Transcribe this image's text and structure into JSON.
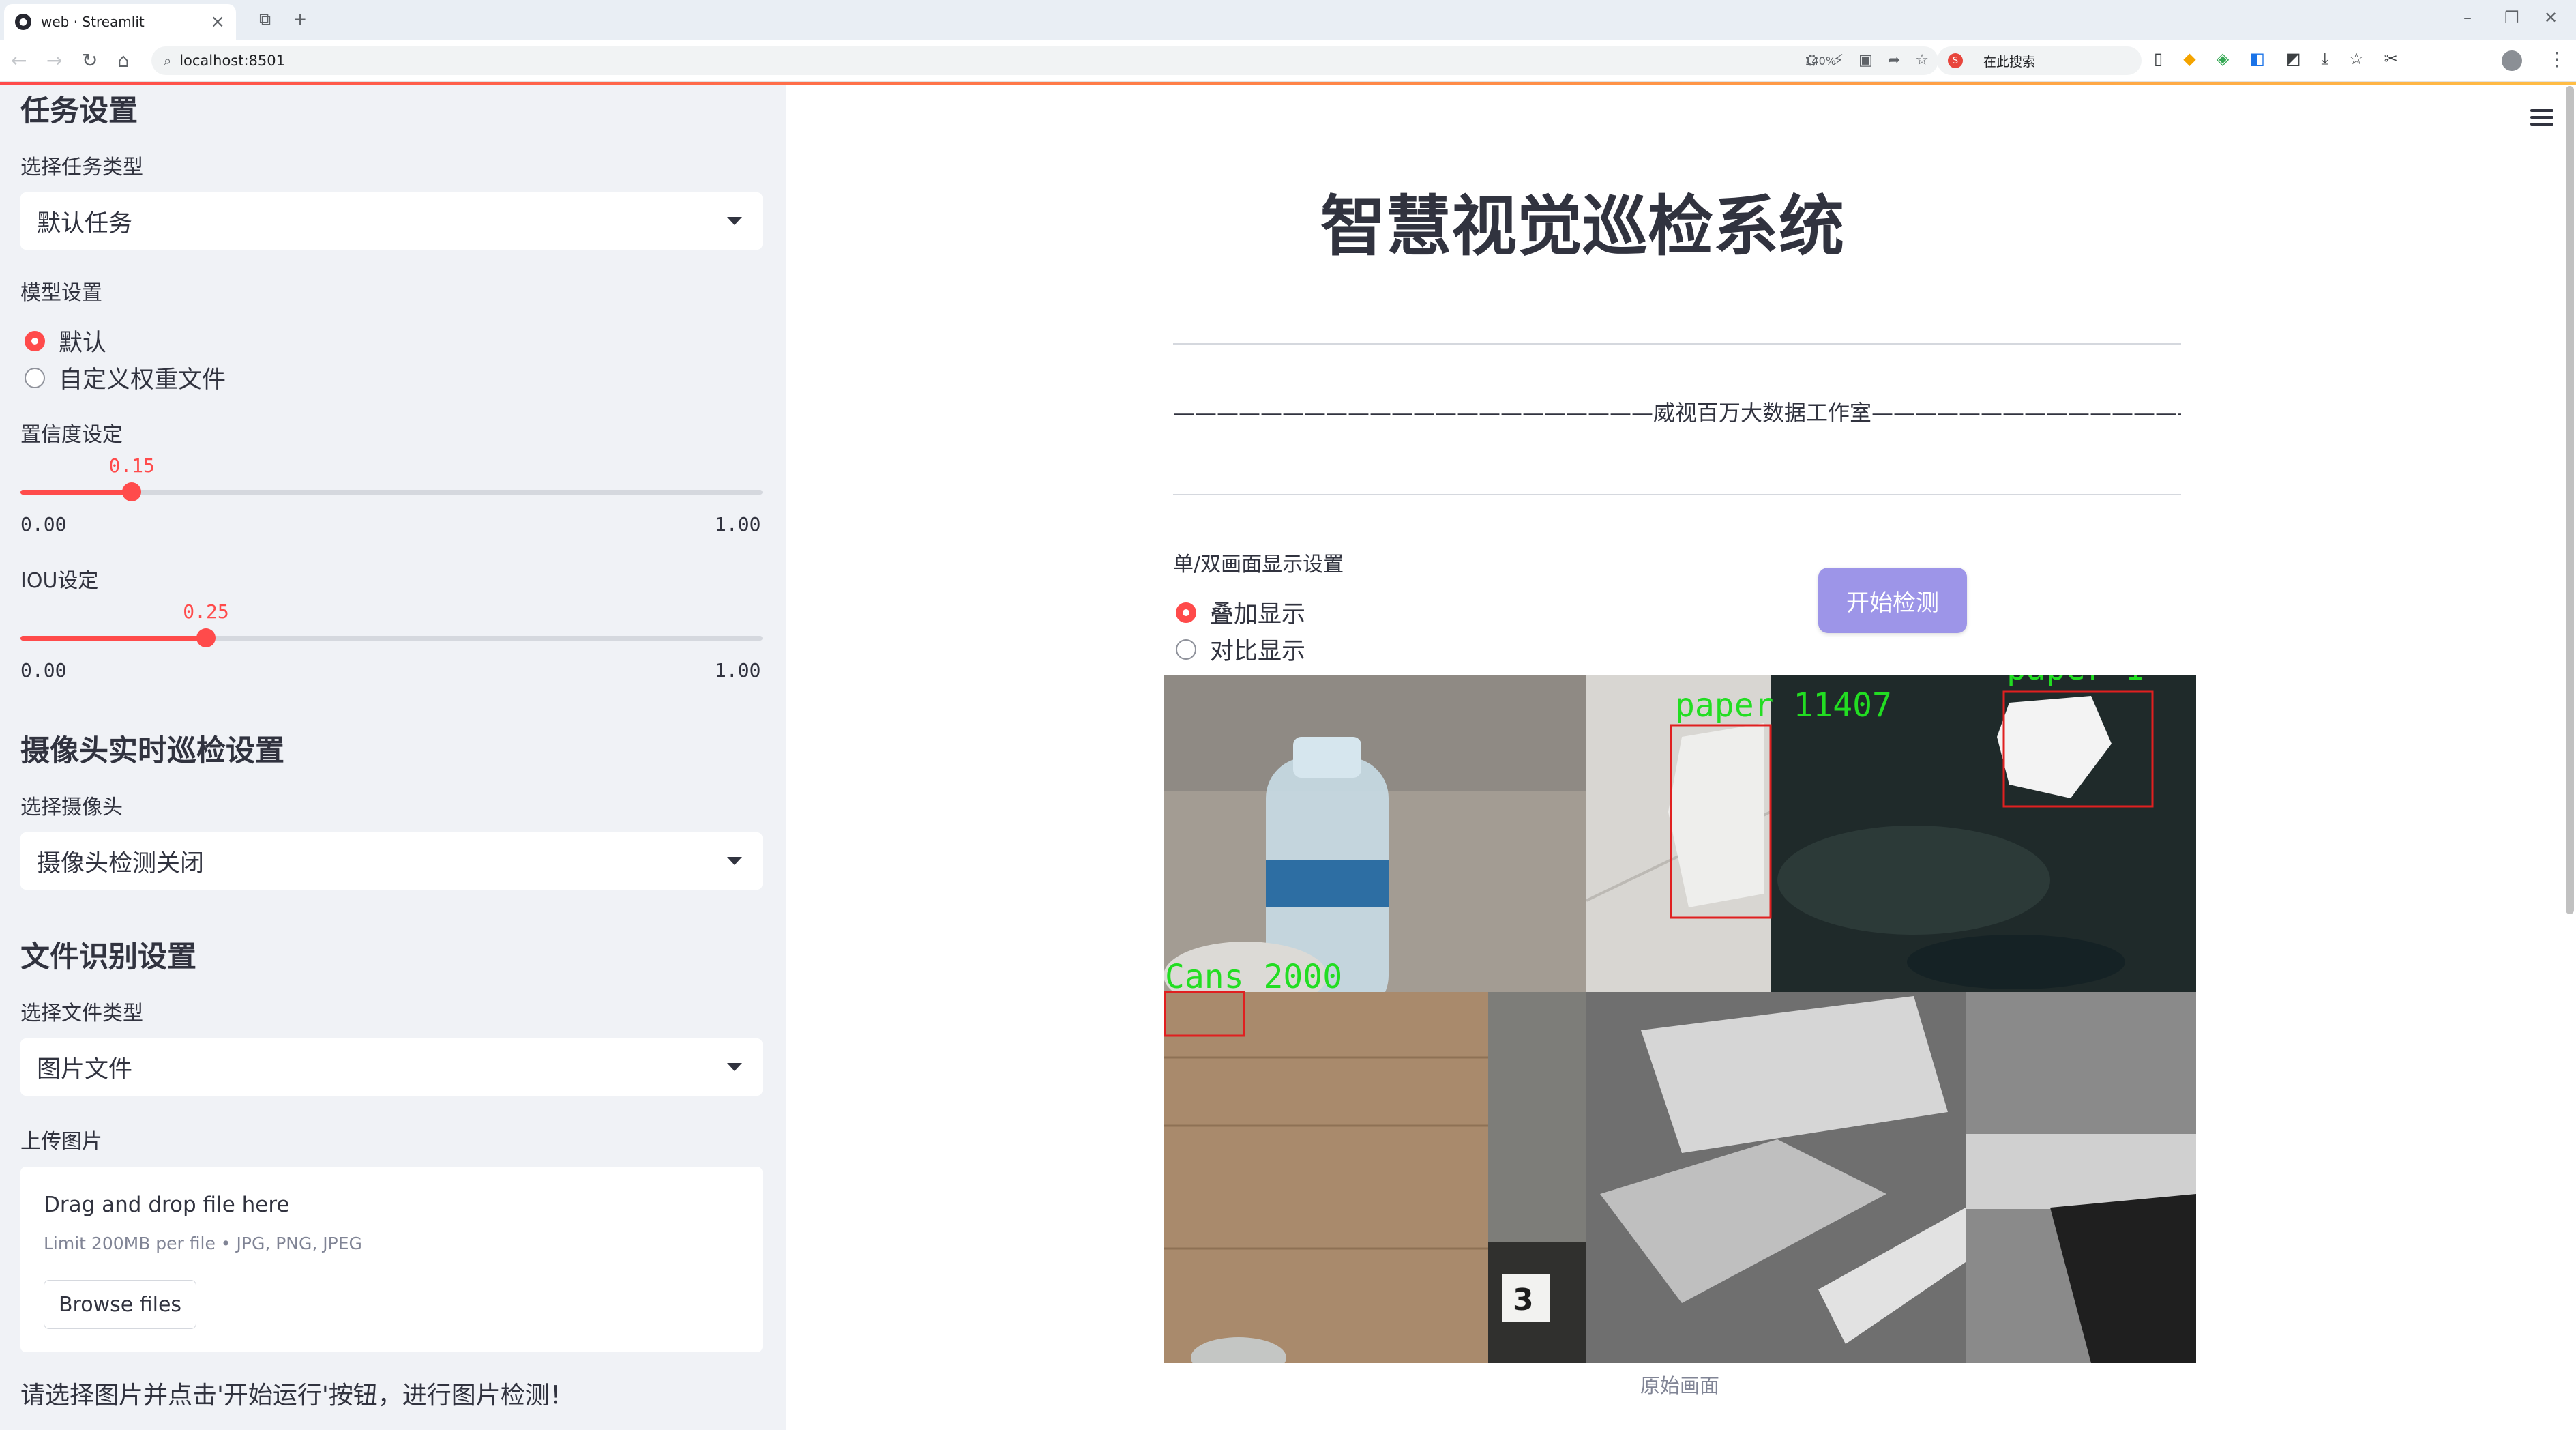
{
  "browser": {
    "tab_title": "web · Streamlit",
    "url": "localhost:8501",
    "zoom": "140%",
    "search_placeholder": "在此搜索"
  },
  "sidebar": {
    "task_heading": "任务设置",
    "task_type_label": "选择任务类型",
    "task_type_value": "默认任务",
    "model_label": "模型设置",
    "model_options": [
      "默认",
      "自定义权重文件"
    ],
    "model_selected": 0,
    "confidence": {
      "label": "置信度设定",
      "value": "0.15",
      "min": "0.00",
      "max": "1.00",
      "fraction": 0.15
    },
    "iou": {
      "label": "IOU设定",
      "value": "0.25",
      "min": "0.00",
      "max": "1.00",
      "fraction": 0.25
    },
    "camera_heading": "摄像头实时巡检设置",
    "camera_label": "选择摄像头",
    "camera_value": "摄像头检测关闭",
    "file_heading": "文件识别设置",
    "file_type_label": "选择文件类型",
    "file_type_value": "图片文件",
    "upload_label": "上传图片",
    "upload": {
      "drag_text": "Drag and drop file here",
      "limit_text": "Limit 200MB per file • JPG, PNG, JPEG",
      "browse_label": "Browse files"
    },
    "hint": "请选择图片并点击'开始运行'按钮，进行图片检测！"
  },
  "main": {
    "title": "智慧视觉巡检系统",
    "subtitle": "——————————————————————威视百万大数据工作室——————————————————————",
    "display_label": "单/双画面显示设置",
    "display_options": [
      "叠加显示",
      "对比显示"
    ],
    "display_selected": 0,
    "start_button": "开始检测",
    "detections": [
      "paper 11407",
      "paper 1",
      "Cans 2000"
    ],
    "panel_digit": "3",
    "caption": "原始画面"
  },
  "colors": {
    "accent": "#ff4b4b",
    "button": "#9d95e8",
    "detection_box": "#e02020",
    "detection_text": "#22dd22"
  }
}
